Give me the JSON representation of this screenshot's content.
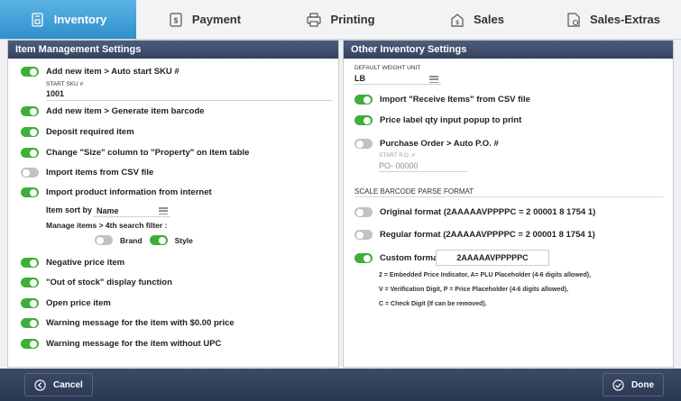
{
  "tabs": [
    {
      "label": "Inventory",
      "icon": "inventory-icon",
      "active": true
    },
    {
      "label": "Payment",
      "icon": "payment-icon",
      "active": false
    },
    {
      "label": "Printing",
      "icon": "printer-icon",
      "active": false
    },
    {
      "label": "Sales",
      "icon": "sales-icon",
      "active": false
    },
    {
      "label": "Sales-Extras",
      "icon": "sales-extras-icon",
      "active": false
    }
  ],
  "left": {
    "header": "Item Management Settings",
    "auto_sku": {
      "label": "Add new item > Auto start SKU #",
      "on": true,
      "field_label": "START SKU #",
      "value": "1001"
    },
    "items": [
      {
        "label": "Add new item > Generate item barcode",
        "on": true
      },
      {
        "label": "Deposit required item",
        "on": true
      },
      {
        "label": "Change \"Size\" column to \"Property\" on item table",
        "on": true
      },
      {
        "label": "Import items from CSV file",
        "on": false
      },
      {
        "label": "Import product information from internet",
        "on": true
      }
    ],
    "sort": {
      "label": "Item sort by",
      "value": "Name"
    },
    "filter": {
      "label": "Manage items > 4th search filter :",
      "opt1": "Brand",
      "opt1_on": false,
      "opt2": "Style",
      "opt2_on": true
    },
    "items2": [
      {
        "label": "Negative price item",
        "on": true
      },
      {
        "label": "\"Out of stock\" display function",
        "on": true
      },
      {
        "label": "Open price item",
        "on": true
      },
      {
        "label": "Warning message for the item with $0.00 price",
        "on": true
      },
      {
        "label": "Warning message for the item without UPC",
        "on": true
      }
    ]
  },
  "right": {
    "header": "Other Inventory Settings",
    "weight": {
      "label": "DEFAULT WEIGHT UNIT",
      "value": "LB"
    },
    "items": [
      {
        "label": "Import \"Receive Items\" from CSV file",
        "on": true
      },
      {
        "label": "Price label qty input popup to print",
        "on": true
      },
      {
        "label": "Purchase Order > Auto P.O. #",
        "on": false
      }
    ],
    "po": {
      "label": "START P.O. #",
      "value": "PO- 00000"
    },
    "scale_title": "SCALE BARCODE PARSE FORMAT",
    "formats": [
      {
        "label": "Original format (2AAAAAVPPPPC = 2 00001 8 1754 1)",
        "on": false
      },
      {
        "label": "Regular format (2AAAAAVPPPPC = 2 00001 8 1754 1)",
        "on": false
      },
      {
        "label": "Custom format",
        "on": true
      }
    ],
    "custom_value": "2AAAAAVPPPPPC",
    "notes": [
      "2 = Embedded Price Indicator, A= PLU Placeholder (4-6 digits allowed),",
      "V = Verification Digit, P = Price Placeholder (4-6 digits allowed),",
      "C = Check Digit (If can be removed)."
    ]
  },
  "footer": {
    "cancel": "Cancel",
    "done": "Done"
  }
}
